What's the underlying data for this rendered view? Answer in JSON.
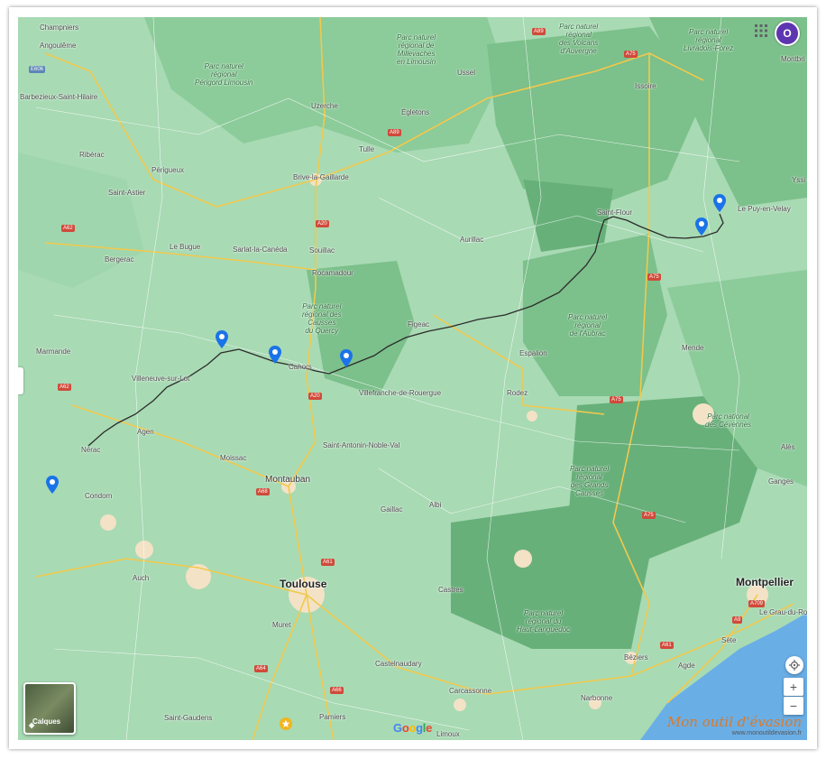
{
  "map": {
    "cities": [
      {
        "id": "champniers",
        "name": "Champniers"
      },
      {
        "id": "angouleme",
        "name": "Angoulême"
      },
      {
        "id": "barbezieux",
        "name": "Barbezieux-Saint-Hilaire"
      },
      {
        "id": "riberac",
        "name": "Ribérac"
      },
      {
        "id": "perigueux",
        "name": "Périgueux"
      },
      {
        "id": "saint-astier",
        "name": "Saint-Astier"
      },
      {
        "id": "le-bugue",
        "name": "Le Bugue"
      },
      {
        "id": "bergerac",
        "name": "Bergerac"
      },
      {
        "id": "sarlat",
        "name": "Sarlat-la-Canéda"
      },
      {
        "id": "uzerche",
        "name": "Uzerche"
      },
      {
        "id": "tulle",
        "name": "Tulle"
      },
      {
        "id": "brive",
        "name": "Brive-la-Gaillarde"
      },
      {
        "id": "egletons",
        "name": "Égletons"
      },
      {
        "id": "ussel",
        "name": "Ussel"
      },
      {
        "id": "souillac",
        "name": "Souillac"
      },
      {
        "id": "rocamadour",
        "name": "Rocamadour"
      },
      {
        "id": "aurillac",
        "name": "Aurillac"
      },
      {
        "id": "figeac",
        "name": "Figeac"
      },
      {
        "id": "cahors",
        "name": "Cahors"
      },
      {
        "id": "villefranche",
        "name": "Villefranche-de-Rouergue"
      },
      {
        "id": "rodez",
        "name": "Rodez"
      },
      {
        "id": "marmande",
        "name": "Marmande"
      },
      {
        "id": "villeneuve",
        "name": "Villeneuve-sur-Lot"
      },
      {
        "id": "agen",
        "name": "Agen"
      },
      {
        "id": "nerac",
        "name": "Nérac"
      },
      {
        "id": "condom",
        "name": "Condom"
      },
      {
        "id": "moissac",
        "name": "Moissac"
      },
      {
        "id": "montauban",
        "name": "Montauban"
      },
      {
        "id": "saint-antonin",
        "name": "Saint-Antonin-Noble-Val"
      },
      {
        "id": "gaillac",
        "name": "Gaillac"
      },
      {
        "id": "albi",
        "name": "Albi"
      },
      {
        "id": "auch",
        "name": "Auch"
      },
      {
        "id": "toulouse",
        "name": "Toulouse"
      },
      {
        "id": "muret",
        "name": "Muret"
      },
      {
        "id": "castres",
        "name": "Castres"
      },
      {
        "id": "castelnaudary",
        "name": "Castelnaudary"
      },
      {
        "id": "carcassonne",
        "name": "Carcassonne"
      },
      {
        "id": "pamiers",
        "name": "Pamiers"
      },
      {
        "id": "saint-gaudens",
        "name": "Saint-Gaudens"
      },
      {
        "id": "limoux",
        "name": "Limoux"
      },
      {
        "id": "beziers",
        "name": "Béziers"
      },
      {
        "id": "narbonne",
        "name": "Narbonne"
      },
      {
        "id": "montpellier",
        "name": "Montpellier"
      },
      {
        "id": "sete",
        "name": "Sète"
      },
      {
        "id": "agde",
        "name": "Agde"
      },
      {
        "id": "grau",
        "name": "Le Grau-du-Roi"
      },
      {
        "id": "ganges",
        "name": "Ganges"
      },
      {
        "id": "espalion",
        "name": "Espalion"
      },
      {
        "id": "mende",
        "name": "Mende"
      },
      {
        "id": "saint-flour",
        "name": "Saint-Flour"
      },
      {
        "id": "issoire",
        "name": "Issoire"
      },
      {
        "id": "le-puy",
        "name": "Le Puy-en-Velay"
      },
      {
        "id": "yssingeaux",
        "name": "Yssi"
      },
      {
        "id": "montbrison",
        "name": "Montbri"
      },
      {
        "id": "ales",
        "name": "Alès"
      }
    ],
    "parks": [
      {
        "id": "millevaches",
        "name": "Parc naturel\nrégional de\nMillevaches\nen Limousin"
      },
      {
        "id": "volcans",
        "name": "Parc naturel\nrégional\ndes Volcans\nd'Auvergne"
      },
      {
        "id": "livradois",
        "name": "Parc naturel\nrégional\nLivradois-Forez"
      },
      {
        "id": "perigord",
        "name": "Parc naturel\nrégional\nPérigord Limousin"
      },
      {
        "id": "causses-quercy",
        "name": "Parc naturel\nrégional des\nCausses\ndu Quercy"
      },
      {
        "id": "aubrac",
        "name": "Parc naturel\nrégional\nde l'Aubrac"
      },
      {
        "id": "cevennes",
        "name": "Parc national\ndes Cévennes"
      },
      {
        "id": "grands-causses",
        "name": "Parc naturel\nrégional\ndes Grands\nCausses"
      },
      {
        "id": "haut-languedoc",
        "name": "Parc naturel\nrégional du\nHaut-Languedoc"
      }
    ],
    "roads": [
      "E606",
      "A89",
      "A75",
      "A20",
      "A89",
      "A62",
      "A20",
      "A62",
      "A68",
      "A61",
      "A66",
      "A64",
      "A9",
      "A709",
      "A75",
      "A75",
      "A75",
      "A61"
    ],
    "markers_count": 6
  },
  "controls": {
    "layers_label": "Calques",
    "google_logo": "Google",
    "avatar_initial": "O",
    "zoom_in": "+",
    "zoom_out": "−"
  },
  "watermark": {
    "title": "Mon outil d'évasion",
    "url": "www.monoutildevasion.fr"
  },
  "colors": {
    "lowland": "#a8dab4",
    "upland": "#7cc08b",
    "forest": "#68b07a",
    "sea": "#6aaee6",
    "urban": "#f3e2c6",
    "route": "#2b2b2b",
    "marker": "#1a73e8",
    "accent": "#d97a2a"
  }
}
